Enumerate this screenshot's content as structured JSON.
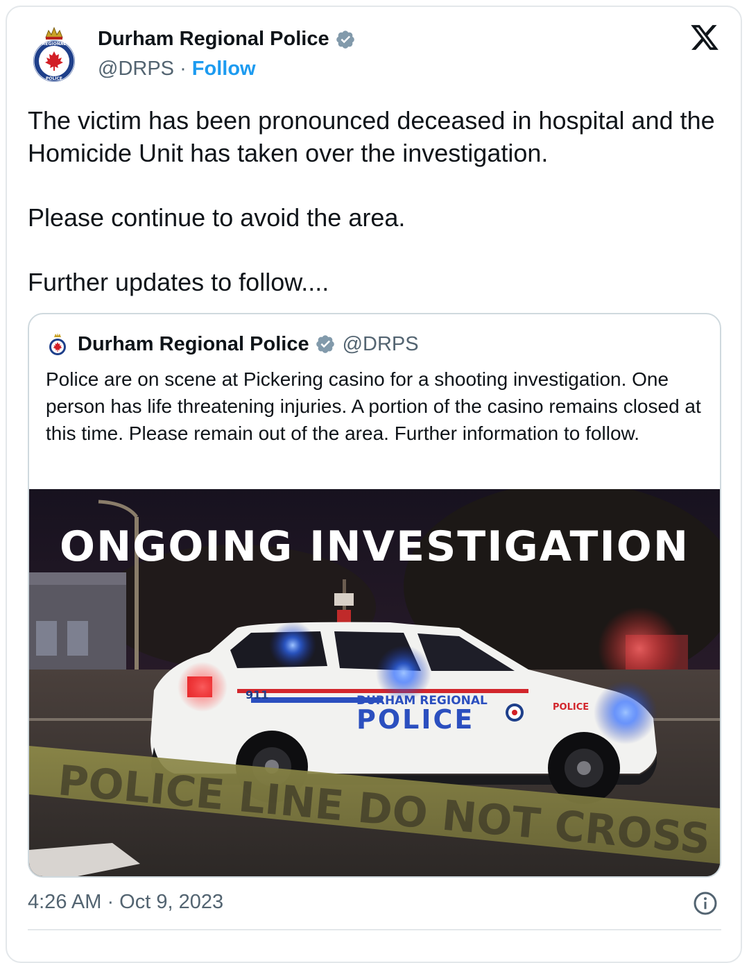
{
  "tweet": {
    "author_name": "Durham Regional Police",
    "handle": "@DRPS",
    "separator": " · ",
    "follow_label": "Follow",
    "text_lines": [
      "The victim has been pronounced deceased in hospital and the Homicide Unit has taken over the investigation.",
      "Please continue to avoid the area.",
      "Further updates to follow...."
    ],
    "timestamp": "4:26 AM · Oct 9, 2023"
  },
  "quoted": {
    "author_name": "Durham Regional Police",
    "handle": "@DRPS",
    "text": "Police are on scene at Pickering casino for a shooting investigation.  One person has life threatening injuries.  A portion of the casino remains closed at this time.  Please remain out of the area. Further information to follow.",
    "image": {
      "overlay_text": "ONGOING INVESTIGATION",
      "car_door_text_1": "DURHAM REGIONAL",
      "car_door_text_2": "POLICE",
      "car_fender_text": "POLICE",
      "car_number": "911",
      "tape_text": "POLICE LINE DO NOT CROSS"
    }
  },
  "icons": {
    "verified": "verified-badge-icon",
    "brand": "x-logo-icon",
    "info": "info-icon",
    "avatar": "police-crest-icon"
  },
  "colors": {
    "link": "#1d9bf0",
    "text": "#0f1419",
    "muted": "#536471",
    "border": "#cfd9de",
    "verified": "#829aab"
  }
}
